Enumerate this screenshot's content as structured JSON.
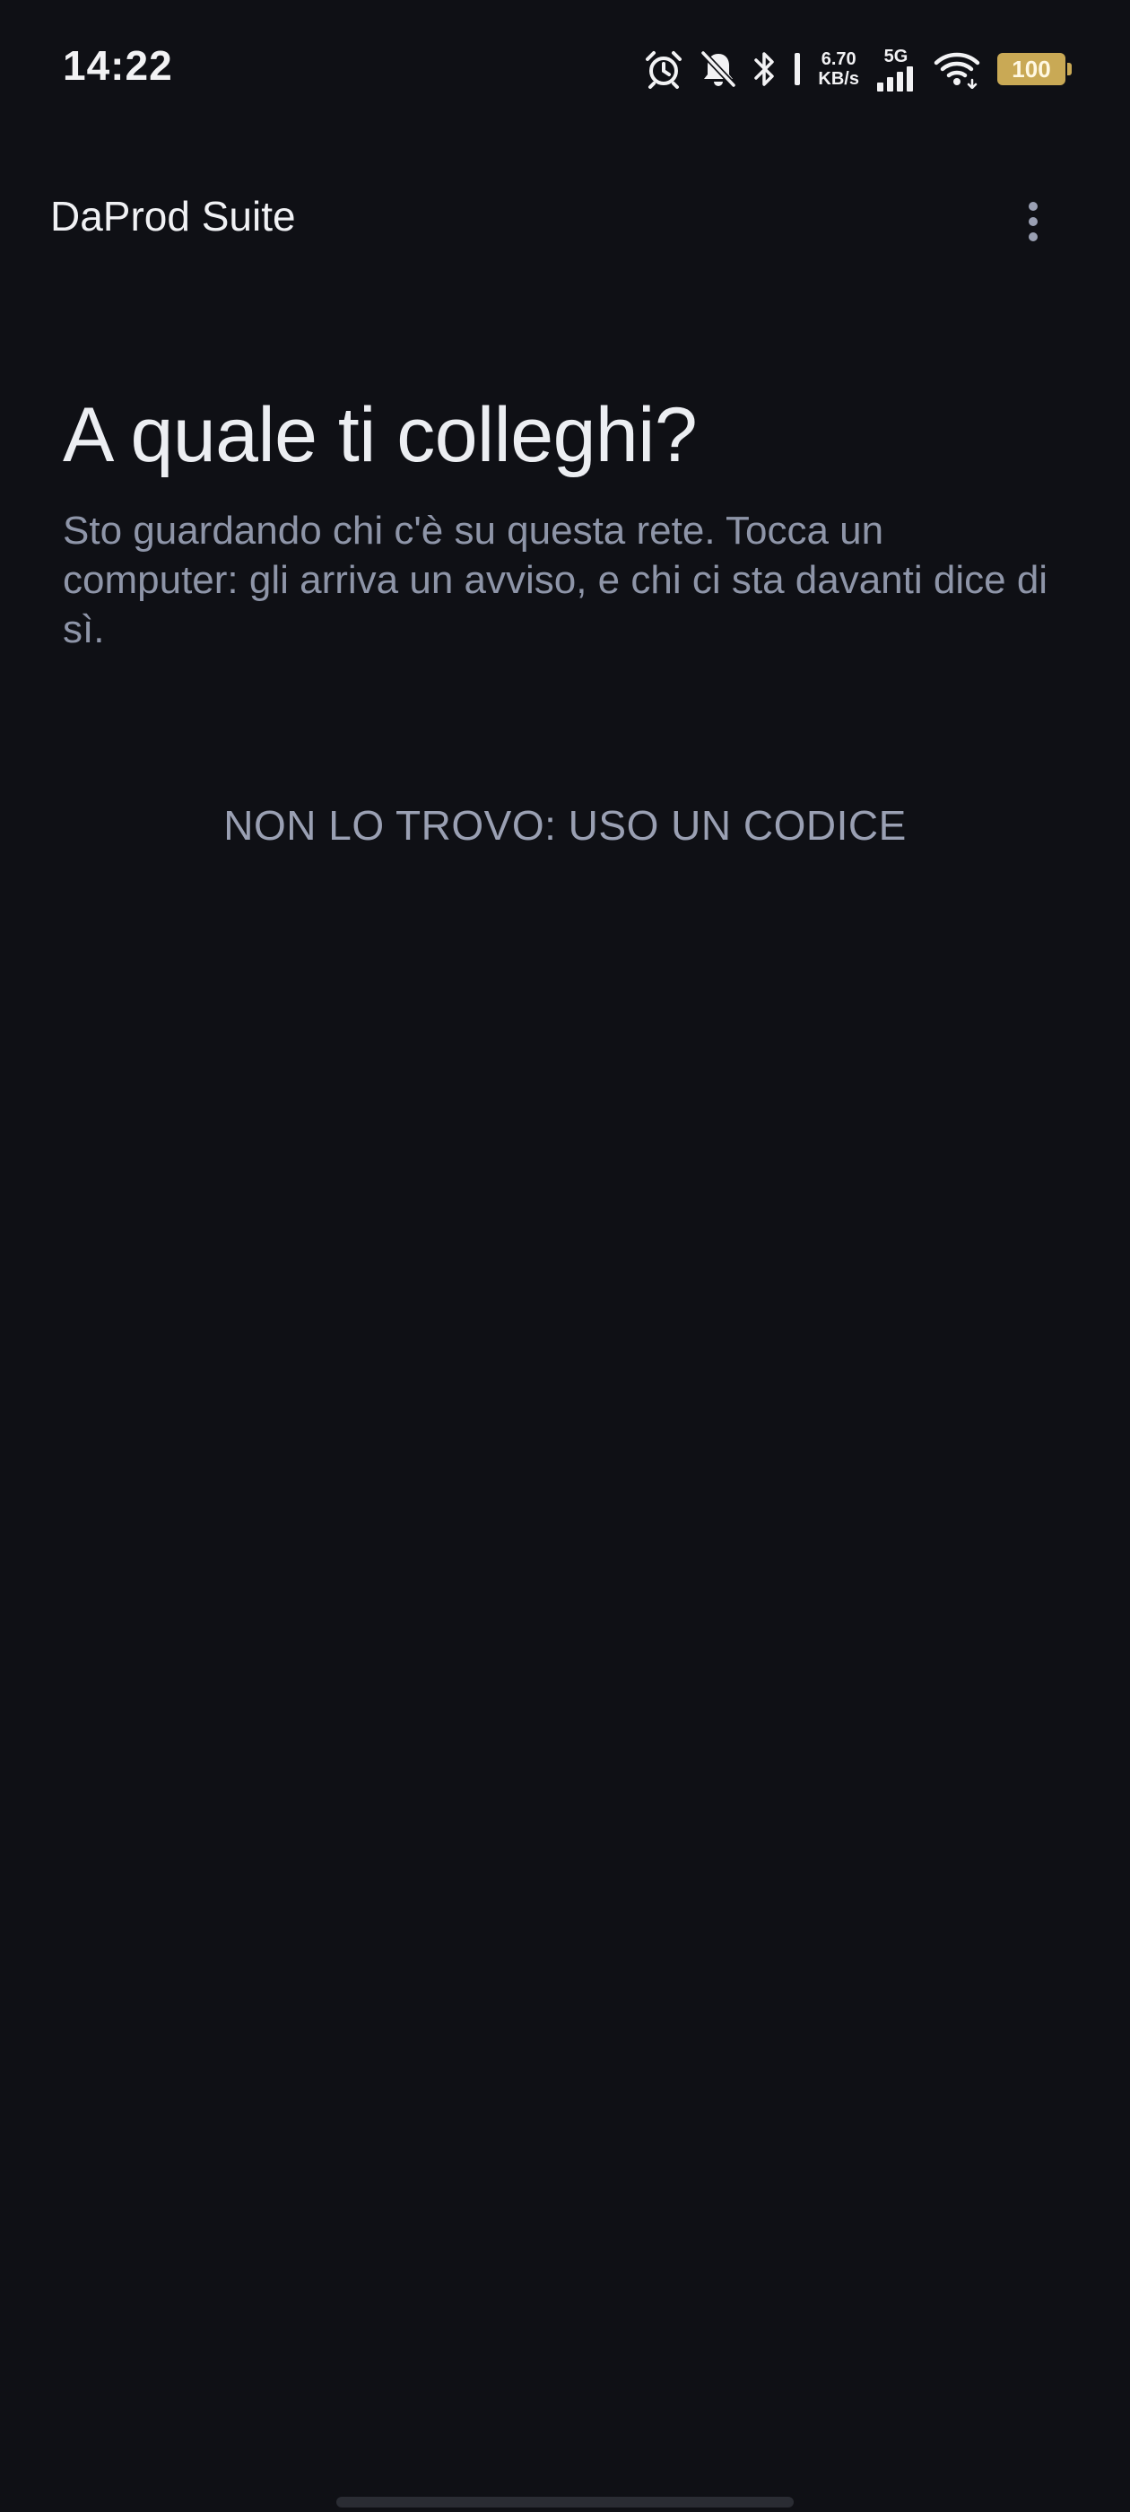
{
  "status_bar": {
    "time": "14:22",
    "net_speed_value": "6.70",
    "net_speed_unit": "KB/s",
    "network_type": "5G",
    "battery_level": "100",
    "icons": [
      "alarm-icon",
      "bell-off-icon",
      "bluetooth-icon",
      "cellular-signal-icon",
      "wifi-icon",
      "battery-icon"
    ]
  },
  "app_bar": {
    "title": "DaProd Suite",
    "menu_icon": "more-vert-icon"
  },
  "main": {
    "heading": "A quale ti colleghi?",
    "subtitle": "Sto guardando chi c'è su questa rete. Tocca un computer: gli arriva un avviso, e chi ci sta davanti dice di sì.",
    "code_button_label": "NON LO TROVO: USO UN CODICE"
  },
  "colors": {
    "background": "#0f1015",
    "heading": "#eceef2",
    "muted_text": "#8e95a8",
    "battery": "#c9a955"
  }
}
